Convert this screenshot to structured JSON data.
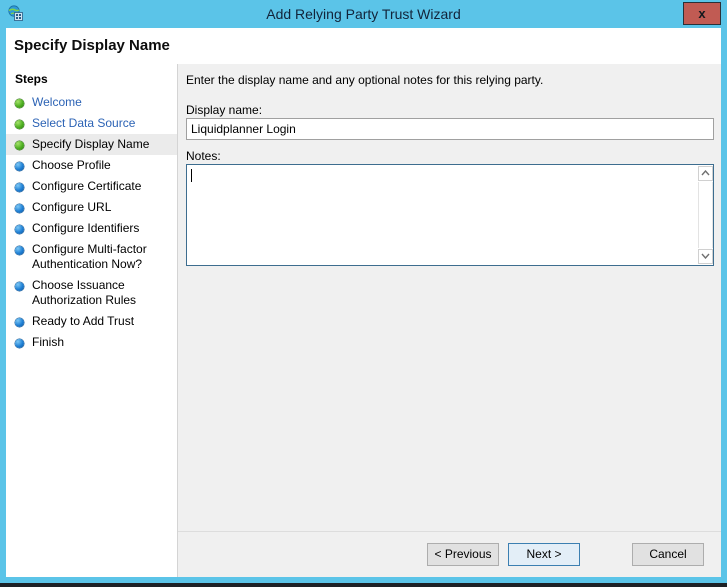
{
  "window": {
    "title": "Add Relying Party Trust Wizard",
    "icon": "adfs-globe-icon",
    "close_label": "x",
    "titlebar_color": "#5bc4e8",
    "close_color": "#c15b53"
  },
  "page": {
    "title": "Specify Display Name"
  },
  "sidebar": {
    "heading": "Steps",
    "items": [
      {
        "label": "Welcome",
        "state": "done",
        "link": true
      },
      {
        "label": "Select Data Source",
        "state": "done",
        "link": true
      },
      {
        "label": "Specify Display Name",
        "state": "done",
        "link": false,
        "current": true
      },
      {
        "label": "Choose Profile",
        "state": "todo",
        "link": false
      },
      {
        "label": "Configure Certificate",
        "state": "todo",
        "link": false
      },
      {
        "label": "Configure URL",
        "state": "todo",
        "link": false
      },
      {
        "label": "Configure Identifiers",
        "state": "todo",
        "link": false
      },
      {
        "label": "Configure Multi-factor Authentication Now?",
        "state": "todo",
        "link": false
      },
      {
        "label": "Choose Issuance Authorization Rules",
        "state": "todo",
        "link": false
      },
      {
        "label": "Ready to Add Trust",
        "state": "todo",
        "link": false
      },
      {
        "label": "Finish",
        "state": "todo",
        "link": false
      }
    ],
    "colors": {
      "done": "#4caf20",
      "todo": "#1e7fd4",
      "link_text": "#2c63b5",
      "current_bg": "#ebebeb"
    }
  },
  "main": {
    "intro": "Enter the display name and any optional notes for this relying party.",
    "display_name": {
      "label": "Display name:",
      "value": "Liquidplanner Login",
      "placeholder": ""
    },
    "notes": {
      "label": "Notes:",
      "value": "",
      "placeholder": ""
    },
    "scrollbar": {
      "up_icon": "chevron-up-icon",
      "down_icon": "chevron-down-icon"
    }
  },
  "buttons": {
    "previous": "< Previous",
    "next": "Next >",
    "cancel": "Cancel"
  }
}
